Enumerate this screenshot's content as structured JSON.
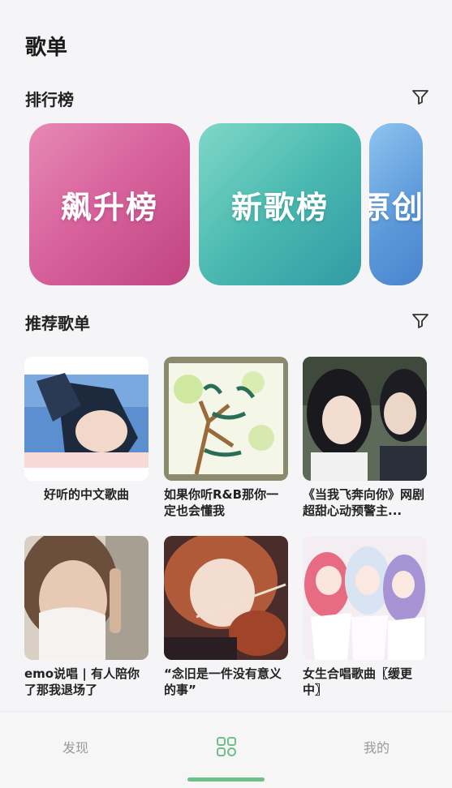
{
  "header": {
    "title": "歌单"
  },
  "ranking": {
    "title": "排行榜",
    "cards": [
      {
        "label": "飙升榜"
      },
      {
        "label": "新歌榜"
      },
      {
        "label": "原创榜"
      }
    ]
  },
  "recommended": {
    "title": "推荐歌单",
    "playlists": [
      {
        "title": "好听的中文歌曲"
      },
      {
        "title": "如果你听R&B那你一定也会懂我"
      },
      {
        "title": "《当我飞奔向你》网剧超甜心动预警主..."
      },
      {
        "title": "emo说唱 | 有人陪你了那我退场了"
      },
      {
        "title": "“念旧是一件没有意义的事”"
      },
      {
        "title": "女生合唱歌曲〖缓更中〗"
      }
    ]
  },
  "tabbar": {
    "tabs": [
      {
        "label": "发现"
      },
      {
        "label": "",
        "icon": "grid-icon",
        "active": true
      },
      {
        "label": "我的"
      }
    ],
    "accent": "#6fbf8a"
  }
}
